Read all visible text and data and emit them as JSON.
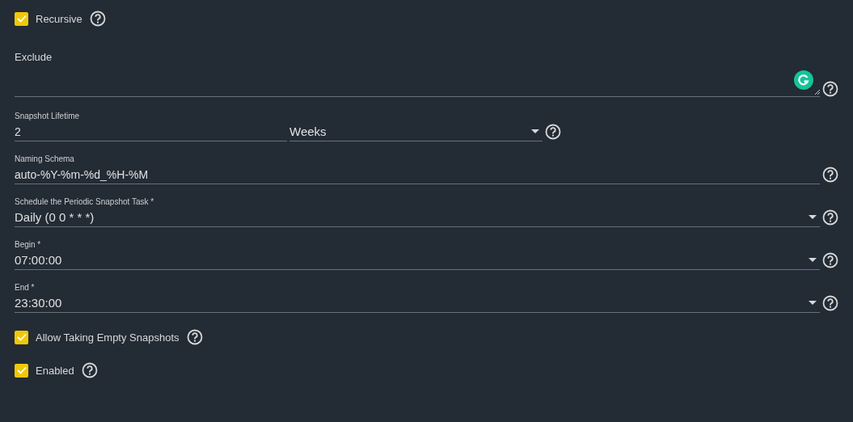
{
  "recursive": {
    "label": "Recursive",
    "checked": true
  },
  "exclude": {
    "label": "Exclude"
  },
  "lifetime": {
    "label": "Snapshot Lifetime",
    "value": "2",
    "unit": "Weeks"
  },
  "fields": [
    {
      "kind": "text",
      "label": "Naming Schema",
      "value": "auto-%Y-%m-%d_%H-%M"
    },
    {
      "kind": "select",
      "label": "Schedule the Periodic Snapshot Task *",
      "value": "Daily (0 0 * * *)"
    },
    {
      "kind": "select",
      "label": "Begin *",
      "value": "07:00:00"
    },
    {
      "kind": "select",
      "label": "End *",
      "value": "23:30:00"
    }
  ],
  "options": [
    {
      "label": "Allow Taking Empty Snapshots",
      "checked": true
    },
    {
      "label": "Enabled",
      "checked": true
    }
  ]
}
